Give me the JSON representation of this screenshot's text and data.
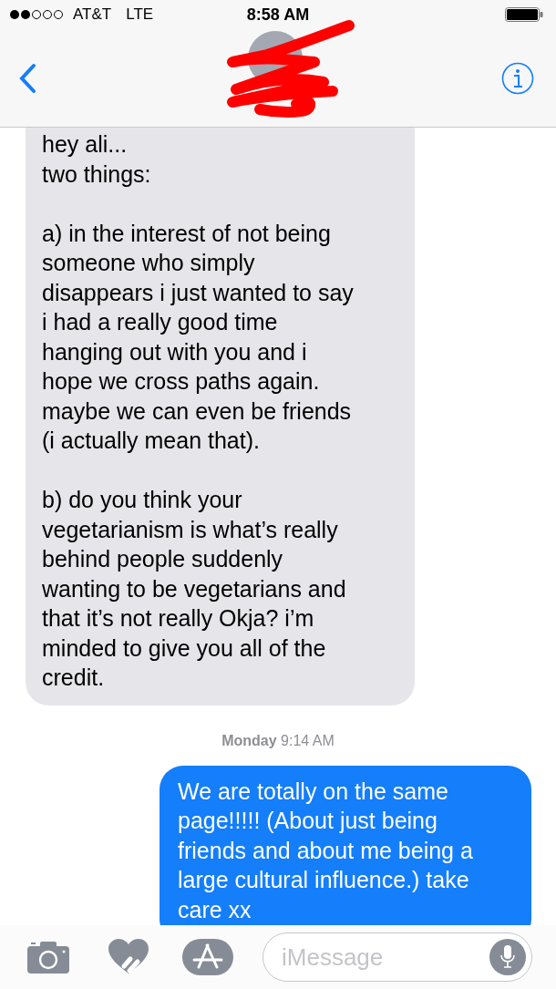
{
  "status_bar": {
    "carrier": "AT&T",
    "network": "LTE",
    "time": "8:58 AM"
  },
  "messages": [
    {
      "kind": "received",
      "text": "hey ali...\ntwo things:\n\na) in the interest of not being\nsomeone who simply\ndisappears i just wanted to say\ni had a really good time\nhanging out with you and i\nhope we cross paths again.\nmaybe we can even be friends\n(i actually mean that).\n\nb) do you think your\nvegetarianism is what’s really\nbehind people suddenly\nwanting to be vegetarians and\nthat it’s not really Okja? i’m\nminded to give you all of the\ncredit."
    },
    {
      "kind": "timestamp",
      "text": "**Monday** 9:14 AM"
    },
    {
      "kind": "sent",
      "text": "We are totally on the same\npage!!!!! (About just being\nfriends and about me being a\nlarge cultural influence.) take\ncare xx"
    }
  ],
  "composer": {
    "placeholder": "iMessage"
  }
}
